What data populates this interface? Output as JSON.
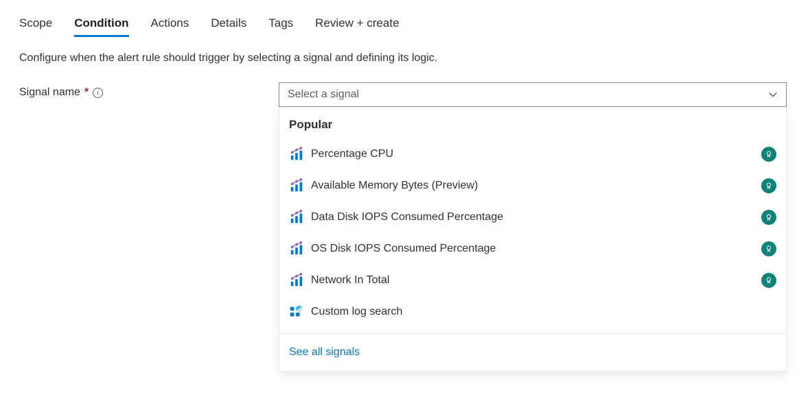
{
  "tabs": {
    "scope": "Scope",
    "condition": "Condition",
    "actions": "Actions",
    "details": "Details",
    "tags": "Tags",
    "review": "Review + create"
  },
  "description": "Configure when the alert rule should trigger by selecting a signal and defining its logic.",
  "field": {
    "label": "Signal name",
    "required_marker": "*"
  },
  "select": {
    "placeholder": "Select a signal"
  },
  "dropdown": {
    "heading": "Popular",
    "items": [
      {
        "label": "Percentage CPU",
        "type": "metric",
        "badge": true
      },
      {
        "label": "Available Memory Bytes (Preview)",
        "type": "metric",
        "badge": true
      },
      {
        "label": "Data Disk IOPS Consumed Percentage",
        "type": "metric",
        "badge": true
      },
      {
        "label": "OS Disk IOPS Consumed Percentage",
        "type": "metric",
        "badge": true
      },
      {
        "label": "Network In Total",
        "type": "metric",
        "badge": true
      },
      {
        "label": "Custom log search",
        "type": "log",
        "badge": false
      }
    ],
    "see_all": "See all signals"
  }
}
